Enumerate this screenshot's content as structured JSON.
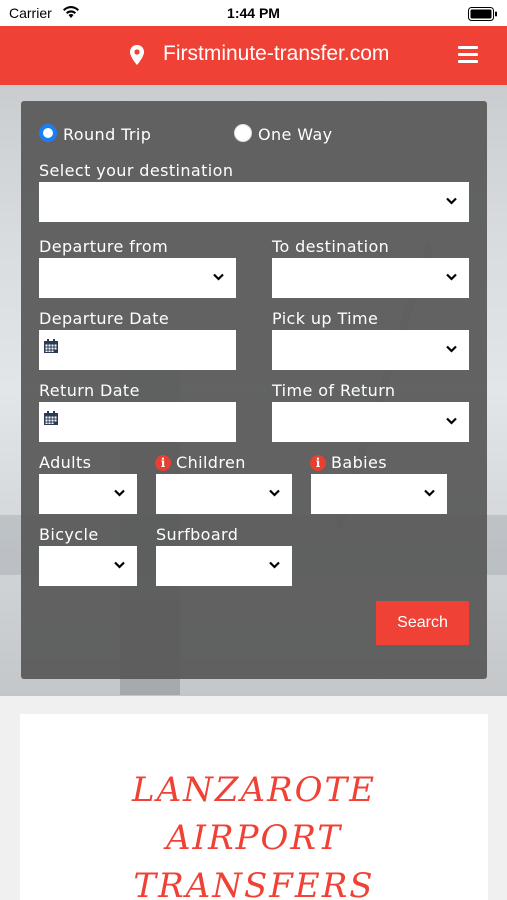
{
  "status_bar": {
    "carrier": "Carrier",
    "time": "1:44 PM"
  },
  "header": {
    "title": "Firstminute-transfer.com",
    "location_icon": "map-marker-icon",
    "menu_icon": "hamburger-menu-icon"
  },
  "trip_type": {
    "round_trip": "Round Trip",
    "one_way": "One Way",
    "selected": "round_trip"
  },
  "form": {
    "destination_label": "Select your destination",
    "departure_from_label": "Departure from",
    "to_destination_label": "To destination",
    "departure_date_label": "Departure Date",
    "pickup_time_label": "Pick up Time",
    "return_date_label": "Return Date",
    "return_time_label": "Time of Return",
    "adults_label": "Adults",
    "children_label": "Children",
    "babies_label": "Babies",
    "bicycle_label": "Bicycle",
    "surfboard_label": "Surfboard",
    "search_button": "Search"
  },
  "promo": {
    "line1": "LANZAROTE",
    "line2": "AIRPORT",
    "line3": "TRANSFERS"
  },
  "colors": {
    "brand_red": "#f04136",
    "radio_blue": "#1a7ff5",
    "panel_gray": "#585858"
  }
}
